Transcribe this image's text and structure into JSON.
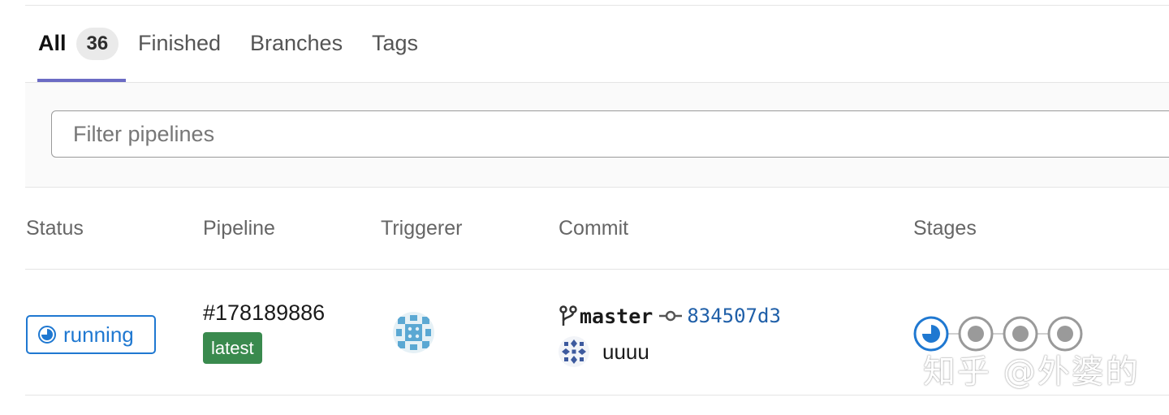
{
  "tabs": [
    {
      "label": "All",
      "count": "36",
      "active": true
    },
    {
      "label": "Finished"
    },
    {
      "label": "Branches"
    },
    {
      "label": "Tags"
    }
  ],
  "filter": {
    "placeholder": "Filter pipelines"
  },
  "table": {
    "headers": {
      "status": "Status",
      "pipeline": "Pipeline",
      "triggerer": "Triggerer",
      "commit": "Commit",
      "stages": "Stages"
    },
    "rows": [
      {
        "status": "running",
        "pipeline_id": "#178189886",
        "badge": "latest",
        "triggerer_avatar": "identicon",
        "branch": "master",
        "sha": "834507d3",
        "commit_title": "uuuu",
        "stages": [
          "running",
          "created",
          "created",
          "created"
        ]
      }
    ]
  },
  "watermark": "知乎 @外婆的",
  "colors": {
    "accent": "#1f78d1",
    "tab_indicator": "#6b6bc4",
    "latest_badge": "#3a8a4e",
    "sha_link": "#1f5fa8"
  }
}
